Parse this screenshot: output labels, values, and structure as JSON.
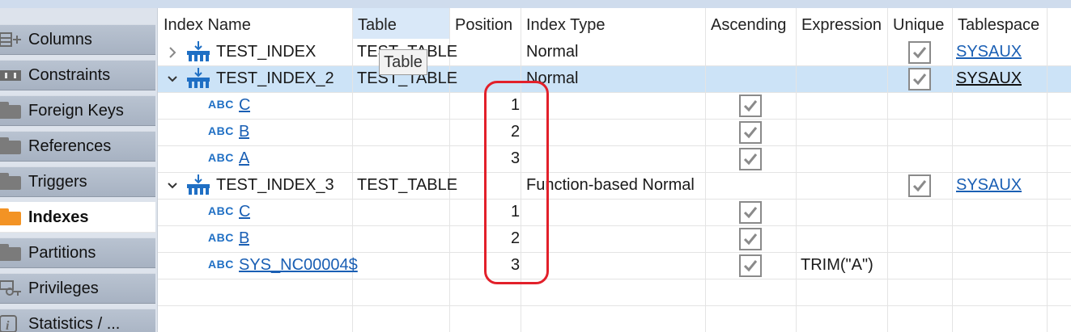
{
  "sidebar": {
    "tabs": [
      {
        "label": "Columns",
        "icon": "columns-icon",
        "active": false
      },
      {
        "label": "Constraints",
        "icon": "constraints-icon",
        "active": false
      },
      {
        "label": "Foreign Keys",
        "icon": "folder-icon",
        "active": false
      },
      {
        "label": "References",
        "icon": "folder-icon",
        "active": false
      },
      {
        "label": "Triggers",
        "icon": "folder-icon",
        "active": false
      },
      {
        "label": "Indexes",
        "icon": "folder-icon",
        "active": true
      },
      {
        "label": "Partitions",
        "icon": "folder-icon",
        "active": false
      },
      {
        "label": "Privileges",
        "icon": "privileges-icon",
        "active": false
      },
      {
        "label": "Statistics / ...",
        "icon": "info-icon",
        "active": false
      }
    ]
  },
  "grid": {
    "columns": [
      "Index Name",
      "Table",
      "Position",
      "Index Type",
      "Ascending",
      "Expression",
      "Unique",
      "Tablespace"
    ],
    "rows": [
      {
        "kind": "index",
        "expanded": false,
        "name": "TEST_INDEX",
        "table": "TEST_TABLE",
        "type": "Normal",
        "unique": true,
        "tablespace": "SYSAUX"
      },
      {
        "kind": "index",
        "expanded": true,
        "selected": true,
        "name": "TEST_INDEX_2",
        "table": "TEST_TABLE",
        "type": "Normal",
        "unique": true,
        "tablespace": "SYSAUX"
      },
      {
        "kind": "column",
        "type_badge": "ABC",
        "name": "C",
        "position": "1",
        "ascending": true
      },
      {
        "kind": "column",
        "type_badge": "ABC",
        "name": "B",
        "position": "2",
        "ascending": true
      },
      {
        "kind": "column",
        "type_badge": "ABC",
        "name": "A",
        "position": "3",
        "ascending": true
      },
      {
        "kind": "index",
        "expanded": true,
        "name": "TEST_INDEX_3",
        "table": "TEST_TABLE",
        "type": "Function-based Normal",
        "unique": true,
        "tablespace": "SYSAUX"
      },
      {
        "kind": "column",
        "type_badge": "ABC",
        "name": "C",
        "position": "1",
        "ascending": true
      },
      {
        "kind": "column",
        "type_badge": "ABC",
        "name": "B",
        "position": "2",
        "ascending": true
      },
      {
        "kind": "column",
        "type_badge": "ABC",
        "name": "SYS_NC00004$",
        "position": "3",
        "ascending": true,
        "expression": "TRIM(\"A\")"
      }
    ]
  },
  "tooltip": {
    "text": "Table"
  },
  "colors": {
    "accent": "#1a5fb4",
    "selection": "#cce3f7",
    "annotation": "#e2202a",
    "folder_active": "#f39324"
  }
}
